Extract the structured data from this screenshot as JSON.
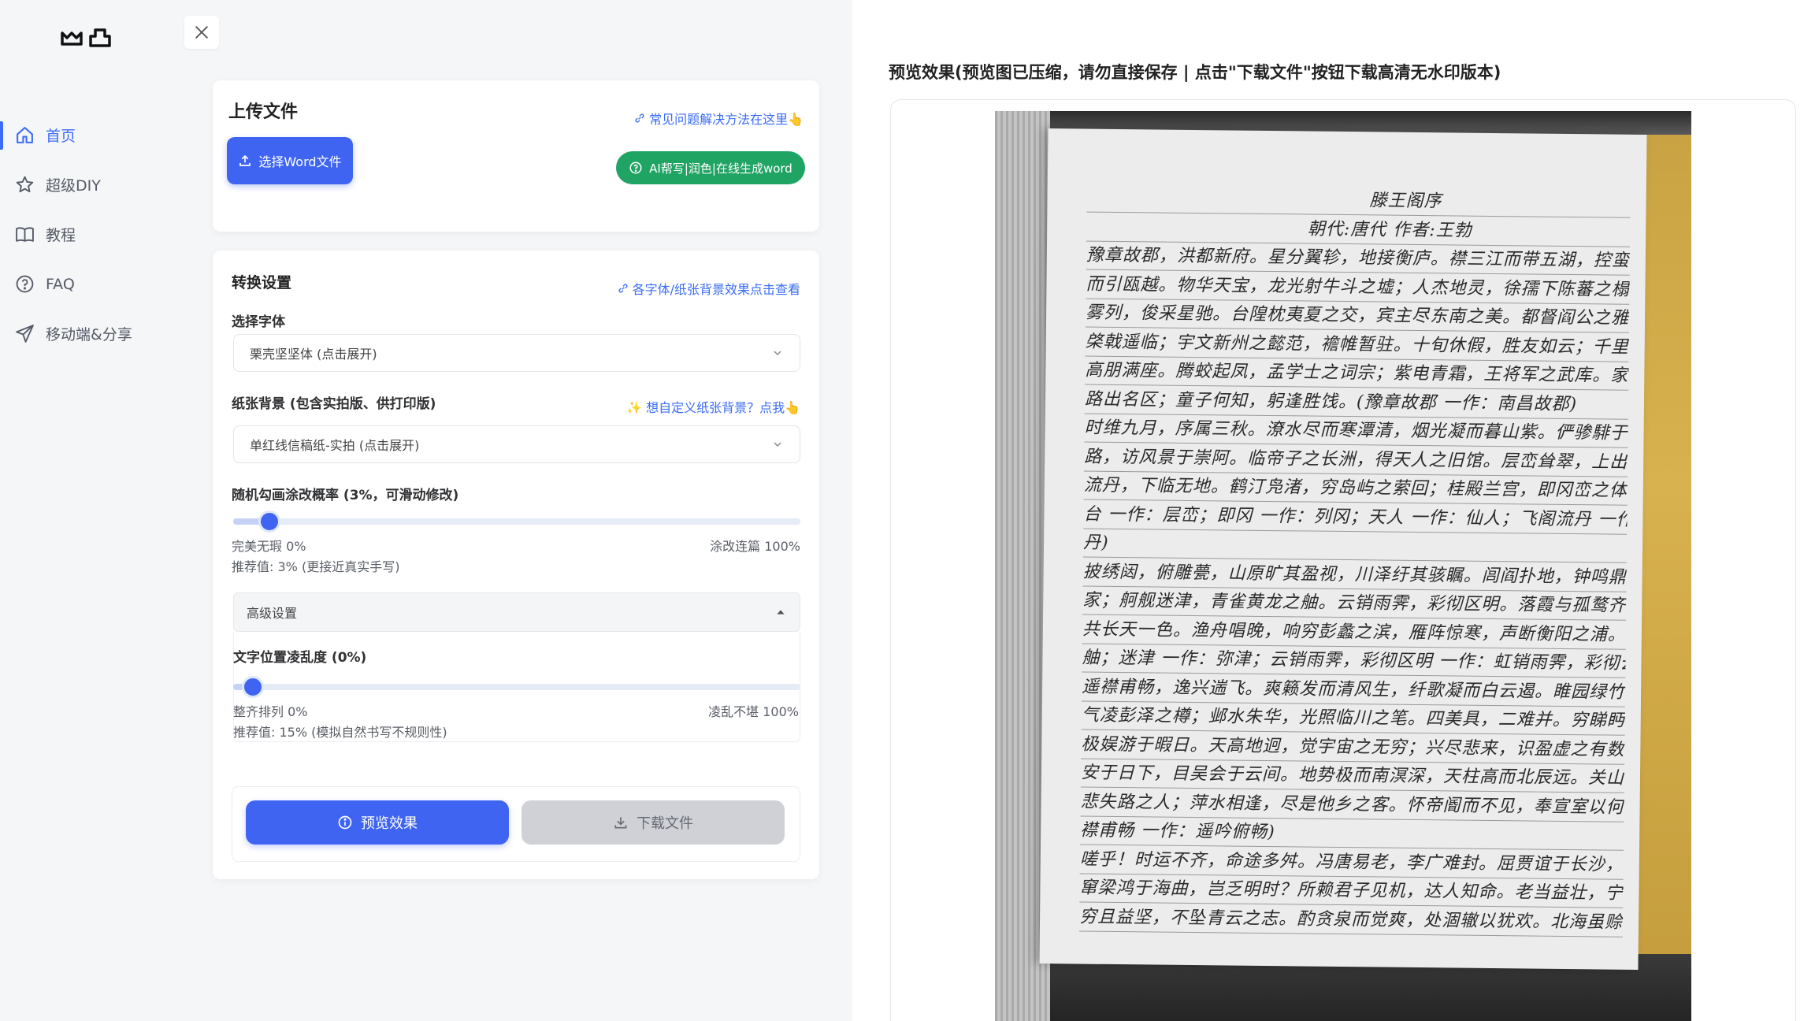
{
  "sidebar": {
    "items": [
      {
        "label": "首页",
        "icon": "home-icon",
        "active": true
      },
      {
        "label": "超级DIY",
        "icon": "star-icon"
      },
      {
        "label": "教程",
        "icon": "book-icon"
      },
      {
        "label": "FAQ",
        "icon": "help-circle-icon"
      },
      {
        "label": "移动端&分享",
        "icon": "send-icon"
      }
    ]
  },
  "upload": {
    "title": "上传文件",
    "faq_link": "常见问题解决方法在这里👆",
    "select_word_button": "选择Word文件",
    "ai_button": "AI帮写|润色|在线生成word"
  },
  "settings": {
    "title": "转换设置",
    "effects_link": "各字体/纸张背景效果点击查看",
    "font_label": "选择字体",
    "font_value": "栗壳坚坚体 (点击展开)",
    "paper_label": "纸张背景 (包含实拍版、供打印版)",
    "custom_paper_link": "✨ 想自定义纸张背景？点我👆",
    "paper_value": "单红线信稿纸-实拍 (点击展开)",
    "scribble_label": "随机勾画涂改概率 (3%，可滑动修改)",
    "scribble_value": 3,
    "scribble_min": "完美无瑕 0%",
    "scribble_max": "涂改连篇 100%",
    "scribble_recommend": "推荐值: 3% (更接近真实手写)",
    "advanced_label": "高级设置",
    "jitter_label": "文字位置凌乱度 (0%)",
    "jitter_value": 0,
    "jitter_min": "整齐排列 0%",
    "jitter_max": "凌乱不堪 100%",
    "jitter_recommend": "推荐值: 15% (模拟自然书写不规则性)",
    "preview_button": "预览效果",
    "download_button": "下载文件"
  },
  "preview": {
    "title": "预览效果(预览图已压缩，请勿直接保存 | 点击\"下载文件\"按钮下载高清无水印版本)",
    "lines": [
      "滕王阁序",
      "朝代:唐代 作者:王勃",
      "豫章故郡，洪都新府。星分翼轸，地接衡庐。襟三江而带五湖，控蛮荆",
      "而引瓯越。物华天宝，龙光射牛斗之墟；人杰地灵，徐孺下陈蕃之榻。雄州",
      "雾列，俊采星驰。台隍枕夷夏之交，宾主尽东南之美。都督阎公之雅望，",
      "棨戟遥临；宇文新州之懿范，襜帷暂驻。十旬休假，胜友如云；千里逢迎，",
      "高朋满座。腾蛟起凤，孟学士之词宗；紫电青霜，王将军之武库。家君作宰，",
      "路出名区；童子何知，躬逢胜饯。(豫章故郡 一作：南昌故郡)",
      "时维九月，序属三秋。潦水尽而寒潭清，烟光凝而暮山紫。俨骖騑于上",
      "路，访风景于崇阿。临帝子之长洲，得天人之旧馆。层峦耸翠，上出重霄；飞阁",
      "流丹，下临无地。鹤汀凫渚，穷岛屿之萦回；桂殿兰宫，即冈峦之体势。(层",
      "台 一作：层峦；即冈 一作：列冈；天人 一作：仙人；飞阁流丹 一作：飞阁翔",
      "丹)",
      "披绣闼，俯雕甍，山原旷其盈视，川泽纡其骇瞩。闾阎扑地，钟鸣鼎食之",
      "家；舸舰迷津，青雀黄龙之舳。云销雨霁，彩彻区明。落霞与孤鹜齐飞，秋水",
      "共长天一色。渔舟唱晚，响穷彭蠡之滨，雁阵惊寒，声断衡阳之浦。(轴 通：",
      "舳；迷津 一作：弥津；云销雨霁，彩彻区明 一作：虹销雨霁，彩彻云衢)",
      "遥襟甫畅，逸兴遄飞。爽籁发而清风生，纤歌凝而白云遏。睢园绿竹，",
      "气凌彭泽之樽；邺水朱华，光照临川之笔。四美具，二难并。穷睇眄于中天，",
      "极娱游于暇日。天高地迥，觉宇宙之无穷；兴尽悲来，识盈虚之有数。望长",
      "安于日下，目吴会于云间。地势极而南溟深，天柱高而北辰远。关山难越，谁",
      "悲失路之人；萍水相逢，尽是他乡之客。怀帝阍而不见，奉宣室以何年？(遥",
      "襟甫畅 一作：遥吟俯畅)",
      "嗟乎！时运不齐，命途多舛。冯唐易老，李广难封。屈贾谊于长沙，非无圣主；",
      "窜梁鸿于海曲，岂乏明时？所赖君子见机，达人知命。老当益壮，宁移白首之心？",
      "穷且益坚，不坠青云之志。酌贪泉而觉爽，处涸辙以犹欢。北海虽赊，扶"
    ]
  }
}
